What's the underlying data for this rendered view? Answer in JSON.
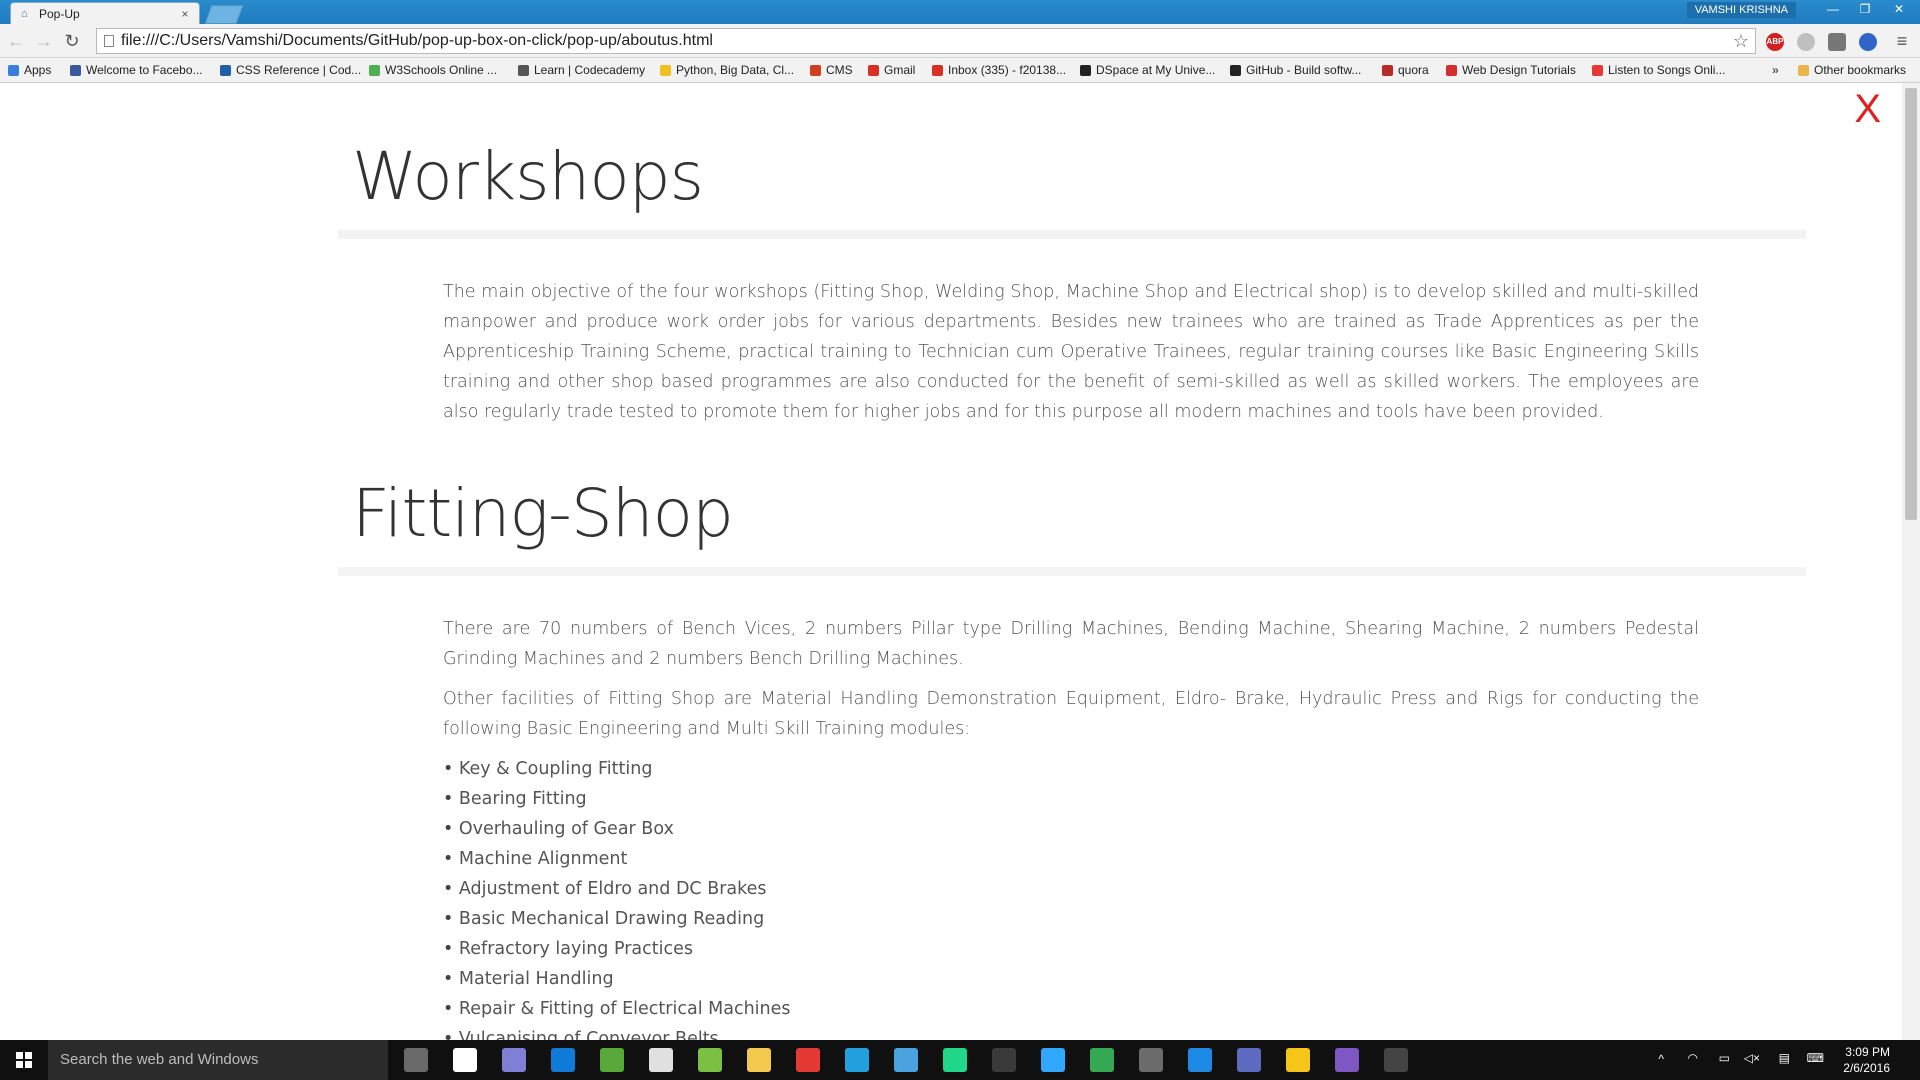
{
  "browser": {
    "tab_title": "Pop-Up",
    "tab_close": "×",
    "user_name": "VAMSHI KRISHNA",
    "url": "file:///C:/Users/Vamshi/Documents/GitHub/pop-up-box-on-click/pop-up/aboutus.html",
    "ext_abp": "ABP"
  },
  "bookmarks": [
    {
      "label": "Apps",
      "color": "#3b7ddd"
    },
    {
      "label": "Welcome to Facebo...",
      "color": "#3b5998"
    },
    {
      "label": "CSS Reference | Cod...",
      "color": "#1f5fa8"
    },
    {
      "label": "W3Schools Online ...",
      "color": "#4caf50"
    },
    {
      "label": "Learn | Codecademy",
      "color": "#555555"
    },
    {
      "label": "Python, Big Data, Cl...",
      "color": "#f0c020"
    },
    {
      "label": "CMS",
      "color": "#d04020"
    },
    {
      "label": "Gmail",
      "color": "#d93025"
    },
    {
      "label": "Inbox (335) - f20138...",
      "color": "#d93025"
    },
    {
      "label": "DSpace at My Unive...",
      "color": "#222222"
    },
    {
      "label": "GitHub - Build softw...",
      "color": "#222222"
    },
    {
      "label": "quora",
      "color": "#b92b27"
    },
    {
      "label": "Web Design Tutorials",
      "color": "#d32f2f"
    },
    {
      "label": "Listen to Songs Onli...",
      "color": "#e53935"
    }
  ],
  "bookmarks_more": "»",
  "bookmarks_other": "Other bookmarks",
  "page": {
    "close_label": "X",
    "section1": {
      "title": "Workshops",
      "body": "The main objective of the four workshops (Fitting Shop, Welding Shop, Machine Shop and Electrical shop) is to develop skilled and multi-skilled manpower and produce work order jobs for various departments. Besides new trainees who are trained as Trade Apprentices as per the Apprenticeship Training Scheme, practical training to Technician cum Operative Trainees, regular training courses like Basic Engineering Skills training and other shop based programmes are also conducted for the benefit of semi-skilled as well as skilled workers. The employees are also regularly trade tested to promote them for higher jobs and for this purpose all modern machines and tools have been provided."
    },
    "section2": {
      "title": "Fitting-Shop",
      "body1": "There are 70 numbers of Bench Vices, 2 numbers Pillar type Drilling Machines, Bending Machine, Shearing Machine, 2 numbers Pedestal Grinding Machines and 2 numbers Bench Drilling Machines.",
      "body2": "Other facilities of Fitting Shop are Material Handling Demonstration Equipment, Eldro- Brake, Hydraulic Press and Rigs for conducting the following Basic Engineering and Multi Skill Training modules:",
      "items": [
        "Key & Coupling Fitting",
        "Bearing Fitting",
        "Overhauling of Gear Box",
        "Machine Alignment",
        "Adjustment of Eldro and DC Brakes",
        "Basic Mechanical Drawing Reading",
        "Refractory laying Practices",
        "Material Handling",
        "Repair & Fitting of Electrical Machines",
        "Vulcanising of Conveyor Belts"
      ]
    }
  },
  "taskbar": {
    "search_placeholder": "Search the web and Windows",
    "time": "3:09 PM",
    "date": "2/6/2016",
    "pinned_colors": [
      "#6a6a6a",
      "#ffffff",
      "#7f7fd5",
      "#0f7ad8",
      "#5aa83a",
      "#e0e0e0",
      "#7bc043",
      "#f2c94c",
      "#e53935",
      "#22a0e0",
      "#4aa3df",
      "#21d789",
      "#3a3a3a",
      "#31a8ff",
      "#34a853",
      "#6b6b6b",
      "#1e88e5",
      "#5c6bc0",
      "#f5c518",
      "#7e57c2",
      "#444444"
    ]
  }
}
